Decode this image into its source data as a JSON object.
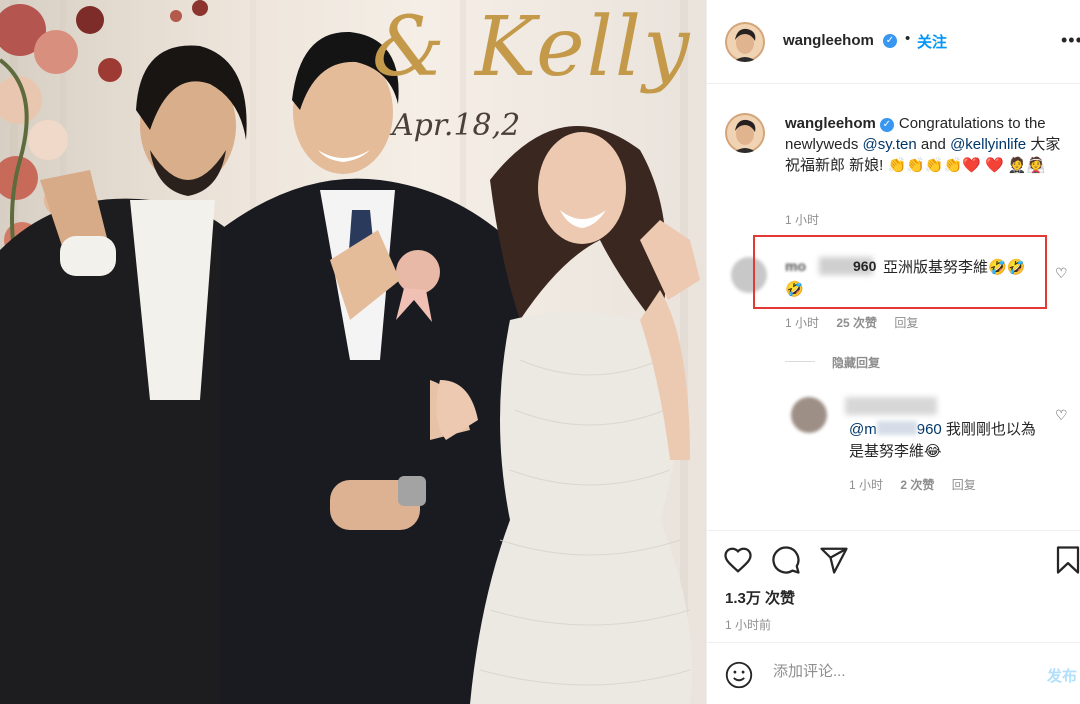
{
  "photo": {
    "sign_text": "& Kelly",
    "sign_date": "Apr.18,2"
  },
  "header": {
    "username": "wangleehom",
    "dot": "•",
    "follow_label": "关注",
    "more_icon": "more-horizontal-icon"
  },
  "caption": {
    "username": "wangleehom",
    "text_before": "Congratulations to the newlyweds ",
    "mention1": "@sy.ten",
    "text_and": " and ",
    "mention2": "@kellyinlife",
    "text_after": " 大家祝福新郎 新娘! 👏👏👏👏❤️ ❤️ 🤵👰",
    "time": "1 小时"
  },
  "comment1": {
    "username": "mo",
    "username_tail": "960",
    "text": "亞洲版基努李維🤣🤣🤣",
    "time": "1 小时",
    "likes": "25 次赞",
    "reply": "回复",
    "highlight_color": "#e53935"
  },
  "hide_replies": "隐藏回复",
  "reply1": {
    "mention": "@m",
    "mention_tail": "960",
    "text": " 我剛剛也以為是基努李維😂",
    "time": "1 小时",
    "likes": "2 次赞",
    "reply": "回复"
  },
  "actions": {
    "like_icon": "heart-icon",
    "comment_icon": "comment-icon",
    "share_icon": "send-icon",
    "save_icon": "bookmark-icon",
    "likes_count": "1.3万 次赞",
    "post_time": "1 小时前"
  },
  "compose": {
    "emoji_icon": "emoji-icon",
    "placeholder": "添加评论...",
    "post_label": "发布"
  },
  "colors": {
    "accent": "#0095f6",
    "verified": "#3897f0",
    "mention": "#00376b",
    "muted": "#8e8e8e"
  }
}
